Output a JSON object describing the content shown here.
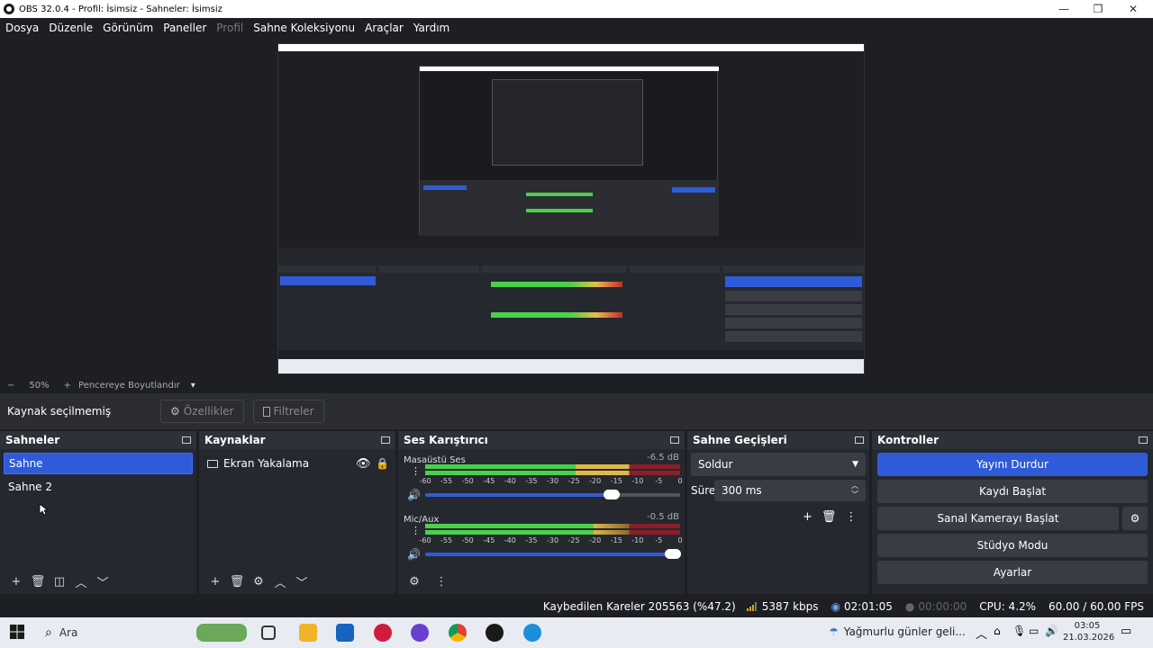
{
  "window": {
    "title": "OBS 32.0.4 - Profil: İsimsiz - Sahneler: İsimsiz",
    "minimize": "—",
    "maximize": "❐",
    "close": "✕"
  },
  "menu": [
    "Dosya",
    "Düzenle",
    "Görünüm",
    "Paneller",
    "Profil",
    "Sahne Koleksiyonu",
    "Araçlar",
    "Yardım"
  ],
  "zoom": {
    "minus": "−",
    "value": "50%",
    "plus": "+",
    "fit": "Pencereye Boyutlandır",
    "caret": "▾"
  },
  "source_toolbar": {
    "no_source": "Kaynak seçilmemiş",
    "properties": "Özellikler",
    "filters": "Filtreler"
  },
  "scenes": {
    "title": "Sahneler",
    "items": [
      "Sahne",
      "Sahne 2"
    ],
    "selected": 0
  },
  "sources": {
    "title": "Kaynaklar",
    "items": [
      "Ekran Yakalama"
    ]
  },
  "mixer": {
    "title": "Ses Karıştırıcı",
    "channels": [
      {
        "name": "Masaüstü Ses",
        "db": "-6.5 dB",
        "volume": 0.73
      },
      {
        "name": "Mic/Aux",
        "db": "-0.5 dB",
        "volume": 0.97
      }
    ],
    "ticks": [
      "-60",
      "-55",
      "-50",
      "-45",
      "-40",
      "-35",
      "-30",
      "-25",
      "-20",
      "-15",
      "-10",
      "-5",
      "0"
    ]
  },
  "transitions": {
    "title": "Sahne Geçişleri",
    "selected": "Soldur",
    "duration_label": "Süre",
    "duration": "300 ms"
  },
  "controls": {
    "title": "Kontroller",
    "buttons": [
      "Yayını Durdur",
      "Kaydı Başlat",
      "Sanal Kamerayı Başlat",
      "Stüdyo Modu",
      "Ayarlar"
    ]
  },
  "status": {
    "dropped": "Kaybedilen Kareler 205563 (%47.2)",
    "bitrate": "5387 kbps",
    "stream_time": "02:01:05",
    "rec_time": "00:00:00",
    "cpu": "CPU: 4.2%",
    "fps": "60.00 / 60.00 FPS"
  },
  "taskbar": {
    "search": "Ara",
    "weather": "Yağmurlu günler geli...",
    "time": "03:05",
    "date": "21.03.2026"
  },
  "icons": {
    "start": "windows-icon",
    "search": "search-icon",
    "eye": "eye-icon",
    "lock": "lock-icon",
    "gear": "gear-icon"
  },
  "colors": {
    "accent": "#2f5bd8",
    "panel": "#262830",
    "background": "#1e1f24"
  }
}
